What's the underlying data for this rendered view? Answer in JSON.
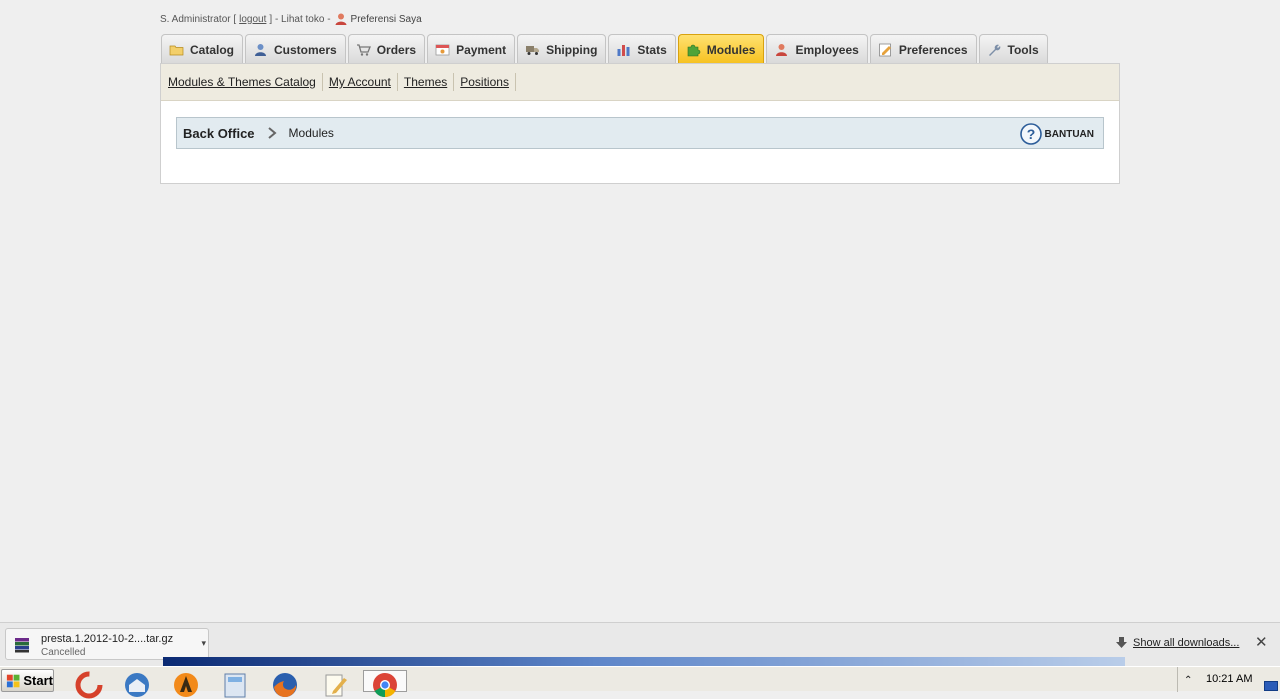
{
  "header": {
    "user_prefix": "S. Administrator [",
    "logout_label": "logout",
    "user_suffix": "] - Lihat toko -",
    "preferences_label": "Preferensi Saya"
  },
  "tabs": [
    {
      "label": "Catalog",
      "icon": "folder-icon",
      "active": false
    },
    {
      "label": "Customers",
      "icon": "customer-icon",
      "active": false
    },
    {
      "label": "Orders",
      "icon": "cart-icon",
      "active": false
    },
    {
      "label": "Payment",
      "icon": "payment-icon",
      "active": false
    },
    {
      "label": "Shipping",
      "icon": "truck-icon",
      "active": false
    },
    {
      "label": "Stats",
      "icon": "bar-chart-icon",
      "active": false
    },
    {
      "label": "Modules",
      "icon": "puzzle-icon",
      "active": true
    },
    {
      "label": "Employees",
      "icon": "employee-icon",
      "active": false
    },
    {
      "label": "Preferences",
      "icon": "preferences-icon",
      "active": false
    },
    {
      "label": "Tools",
      "icon": "wrench-icon",
      "active": false
    }
  ],
  "subnav": [
    "Modules & Themes Catalog",
    "My Account",
    "Themes",
    "Positions"
  ],
  "breadcrumb": {
    "home": "Back Office",
    "current": "Modules",
    "help_label": "BANTUAN"
  },
  "downloads": {
    "file_name": "presta.1.2012-10-2....tar.gz",
    "status": "Cancelled",
    "show_all": "Show all downloads..."
  },
  "taskbar": {
    "start_label": "Start",
    "apps": [
      "ccleaner-icon",
      "thunderbird-icon",
      "avast-icon",
      "calculator-icon",
      "firefox-icon",
      "notepad-icon",
      "chrome-icon"
    ],
    "clock": "10:21 AM"
  },
  "colors": {
    "active_tab": "#f6c11f",
    "subnav_bg": "#eeebe0",
    "breadcrumb_bg": "#e2ebf0"
  }
}
